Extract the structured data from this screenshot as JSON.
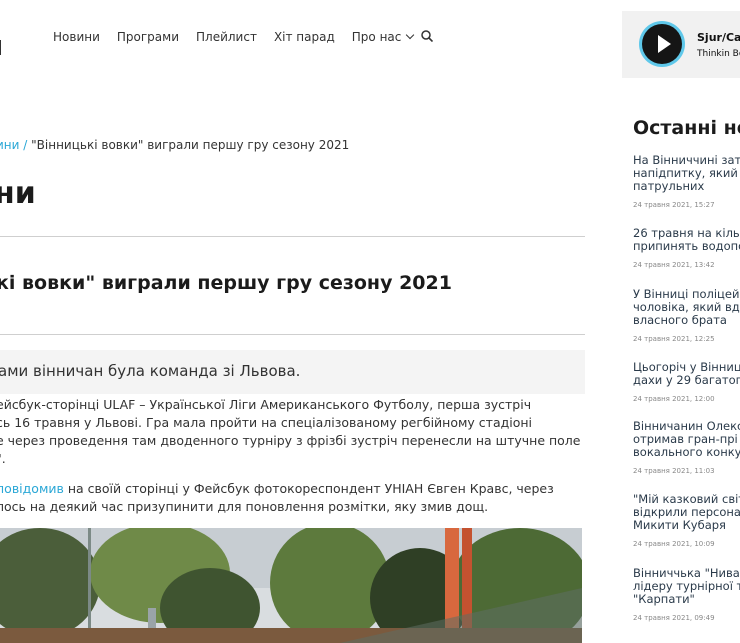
{
  "header": {
    "logo_top": "Р",
    "logo_bottom": "И",
    "nav": [
      "Новини",
      "Програми",
      "Плейлист",
      "Хіт парад",
      "Про нас"
    ]
  },
  "player": {
    "track_title": "Sjur/Cai",
    "track_artist": "Thinkin Bo"
  },
  "breadcrumb": {
    "parent": "ини",
    "separator": "/",
    "current": "\"Вінницькі вовки\" виграли першу гру сезону 2021"
  },
  "page_title": "ни",
  "article": {
    "title": "кі вовки\" виграли першу гру сезону 2021",
    "lead": "ами вінничан була команда зі Львова.",
    "p1_lines": [
      "ейсбук-сторінці ULAF – Української Ліги Американського Футболу, перша зустріч",
      "сь 16 травня у Львові. Гра мала пройти на спеціалізованому регбійному стадіоні",
      "е через проведення там дводенного турніру з фрізбі зустріч перенесли на штучне поле",
      "\"."
    ],
    "p2_link": "повідомив",
    "p2_rest_line1": " на своїй сторінці у Фейсбук фотокореспондент УНІАН Євген Кравс, через",
    "p2_line2": "лось на деякий час призупинити для поновлення розмітки, яку змив дощ."
  },
  "sidebar": {
    "heading": "Останні но",
    "news": [
      {
        "title": "На Вінниччині зат\nнапідпитку, який т\nпатрульних",
        "date": "24 травня 2021, 15:27"
      },
      {
        "title": "26 травня на кільк\nприпинять водопо",
        "date": "24 травня 2021, 13:42"
      },
      {
        "title": "У Вінниці поліцей\nчоловіка, який вда\nвласного брата",
        "date": "24 травня 2021, 12:25"
      },
      {
        "title": "Цьогоріч у Вінниці\nдахи у 29 багатопо",
        "date": "24 травня 2021, 12:00"
      },
      {
        "title": "Вінничанин Олекс\nотримав гран-прі\nвокального конкур",
        "date": "24 травня 2021, 11:03"
      },
      {
        "title": "\"Мій казковий світ\nвідкрили персона\nМикити Кубаря",
        "date": "24 травня 2021, 10:09"
      },
      {
        "title": "Вінниччька \"Нива\"\nлідеру турнірної т\n\"Карпати\"",
        "date": "24 травня 2021, 09:49"
      }
    ]
  },
  "colors": {
    "accent": "#2aa7d6",
    "play_ring": "#5fc8ea",
    "text": "#222222"
  }
}
